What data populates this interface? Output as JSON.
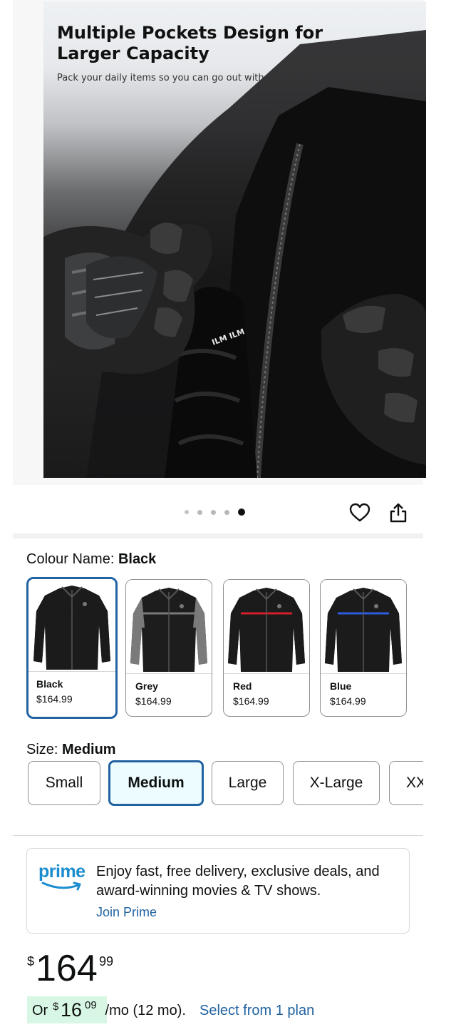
{
  "hero": {
    "title": "Multiple Pockets Design for Larger Capacity",
    "subtitle": "Pack your daily items so you can go out without burden",
    "label": "ILM ILM"
  },
  "gallery": {
    "dot_count": 5,
    "active_index": 4
  },
  "actions": {
    "wishlist_icon": "heart-icon",
    "share_icon": "share-icon"
  },
  "colour": {
    "label": "Colour Name: ",
    "selected": "Black",
    "options": [
      {
        "name": "Black",
        "price": "$164.99",
        "stripe": "#1a1a1a",
        "body": "#1b1b1b",
        "sleeve": "#1b1b1b"
      },
      {
        "name": "Grey",
        "price": "$164.99",
        "stripe": "#7a7a7a",
        "body": "#1d1d1d",
        "sleeve": "#7a7a7a"
      },
      {
        "name": "Red",
        "price": "$164.99",
        "stripe": "#d21f2a",
        "body": "#1b1b1b",
        "sleeve": "#1b1b1b"
      },
      {
        "name": "Blue",
        "price": "$164.99",
        "stripe": "#2c5be0",
        "body": "#1b1b1b",
        "sleeve": "#1b1b1b"
      }
    ]
  },
  "size": {
    "label": "Size: ",
    "selected": "Medium",
    "options": [
      "Small",
      "Medium",
      "Large",
      "X-Large",
      "XX"
    ]
  },
  "prime": {
    "logo": "prime",
    "text": "Enjoy fast, free delivery, exclusive deals, and award-winning movies & TV shows.",
    "link": "Join Prime"
  },
  "price": {
    "symbol": "$",
    "whole": "164",
    "fraction": "99"
  },
  "monthly": {
    "prefix": "Or ",
    "symbol": "$",
    "whole": "16",
    "fraction": "09",
    "suffix": " /mo (12 mo). ",
    "link": "Select from 1 plan"
  },
  "colors": {
    "link": "#2162a1",
    "selected_border": "#2162a1",
    "prime_blue": "#1a8ccf",
    "monthly_highlight": "#d7f7e4"
  }
}
